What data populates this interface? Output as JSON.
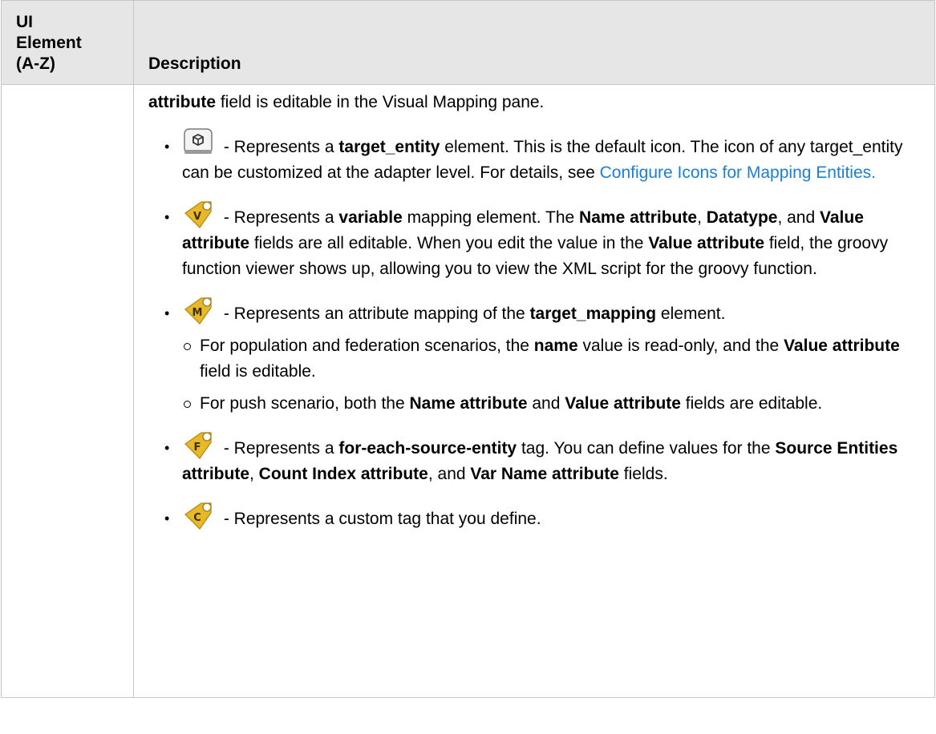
{
  "table": {
    "header": {
      "col1_line1": "UI",
      "col1_line2": "Element",
      "col1_line3": "(A-Z)",
      "col2": "Description"
    }
  },
  "content": {
    "lead": {
      "b1": "attribute",
      "t1": " field is editable in the Visual Mapping pane."
    },
    "item_target_entity": {
      "icon": "target-entity-icon",
      "t1": " - Represents a ",
      "b1": "target_entity",
      "t2": " element. This is the default icon. The icon of any target_entity can be customized at the adapter level. For details, see ",
      "link": "Configure Icons for Mapping Entities."
    },
    "item_variable": {
      "icon": "variable-icon",
      "icon_letter": "V",
      "t1": " - Represents a ",
      "b1": "variable",
      "t2": " mapping element. The ",
      "b2": "Name attribute",
      "t3": ", ",
      "b3": "Datatype",
      "t4": ", and ",
      "b4": "Value attribute",
      "t5": " fields are all editable. When you edit the value in the ",
      "b5": "Value attribute",
      "t6": " field, the groovy function viewer shows up, allowing you to view the XML script for the groovy function."
    },
    "item_mapping": {
      "icon": "mapping-icon",
      "icon_letter": "M",
      "t1": " - Represents an attribute mapping of the ",
      "b1": "target_mapping",
      "t2": " element.",
      "sub1": {
        "t1": "For population and federation scenarios, the ",
        "b1": "name",
        "t2": " value is read-only, and the ",
        "b2": "Value attribute",
        "t3": " field is editable."
      },
      "sub2": {
        "t1": "For push scenario, both the ",
        "b1": "Name attribute",
        "t2": " and ",
        "b2": "Value attribute",
        "t3": " fields are editable."
      }
    },
    "item_foreach": {
      "icon": "for-each-icon",
      "icon_letter": "F",
      "t1": " - Represents a ",
      "b1": "for-each-source-entity",
      "t2": " tag. You can define values for the ",
      "b2": "Source Entities attribute",
      "t3": ", ",
      "b3": "Count Index attribute",
      "t4": ", and ",
      "b4": "Var Name attribute",
      "t5": " fields."
    },
    "item_custom": {
      "icon": "custom-tag-icon",
      "icon_letter": "C",
      "t1": " - Represents a custom tag that you define."
    }
  },
  "colors": {
    "header_bg": "#e6e6e6",
    "border": "#c6c6c6",
    "link": "#1a7fd8",
    "tag_fill": "#e6b82a"
  }
}
